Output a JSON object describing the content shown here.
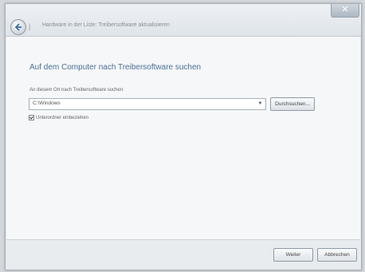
{
  "titlebar": {
    "close_label": "✕",
    "breadcrumb": "Hardware in der Liste: Treibersoftware aktualisieren"
  },
  "main": {
    "heading": "Auf dem Computer nach Treibersoftware suchen",
    "path_label": "An diesem Ort nach Treibersoftware suchen:",
    "path_value": "C:\\Windows",
    "browse_label": "Durchsuchen...",
    "subfolders_label": "Unterordner einbeziehen",
    "subfolders_checked": true
  },
  "footer": {
    "next_label": "Weiter",
    "cancel_label": "Abbrechen"
  },
  "icons": {
    "back": "back-arrow-icon",
    "dropdown": "chevron-down-icon",
    "check": "checkmark-icon"
  }
}
